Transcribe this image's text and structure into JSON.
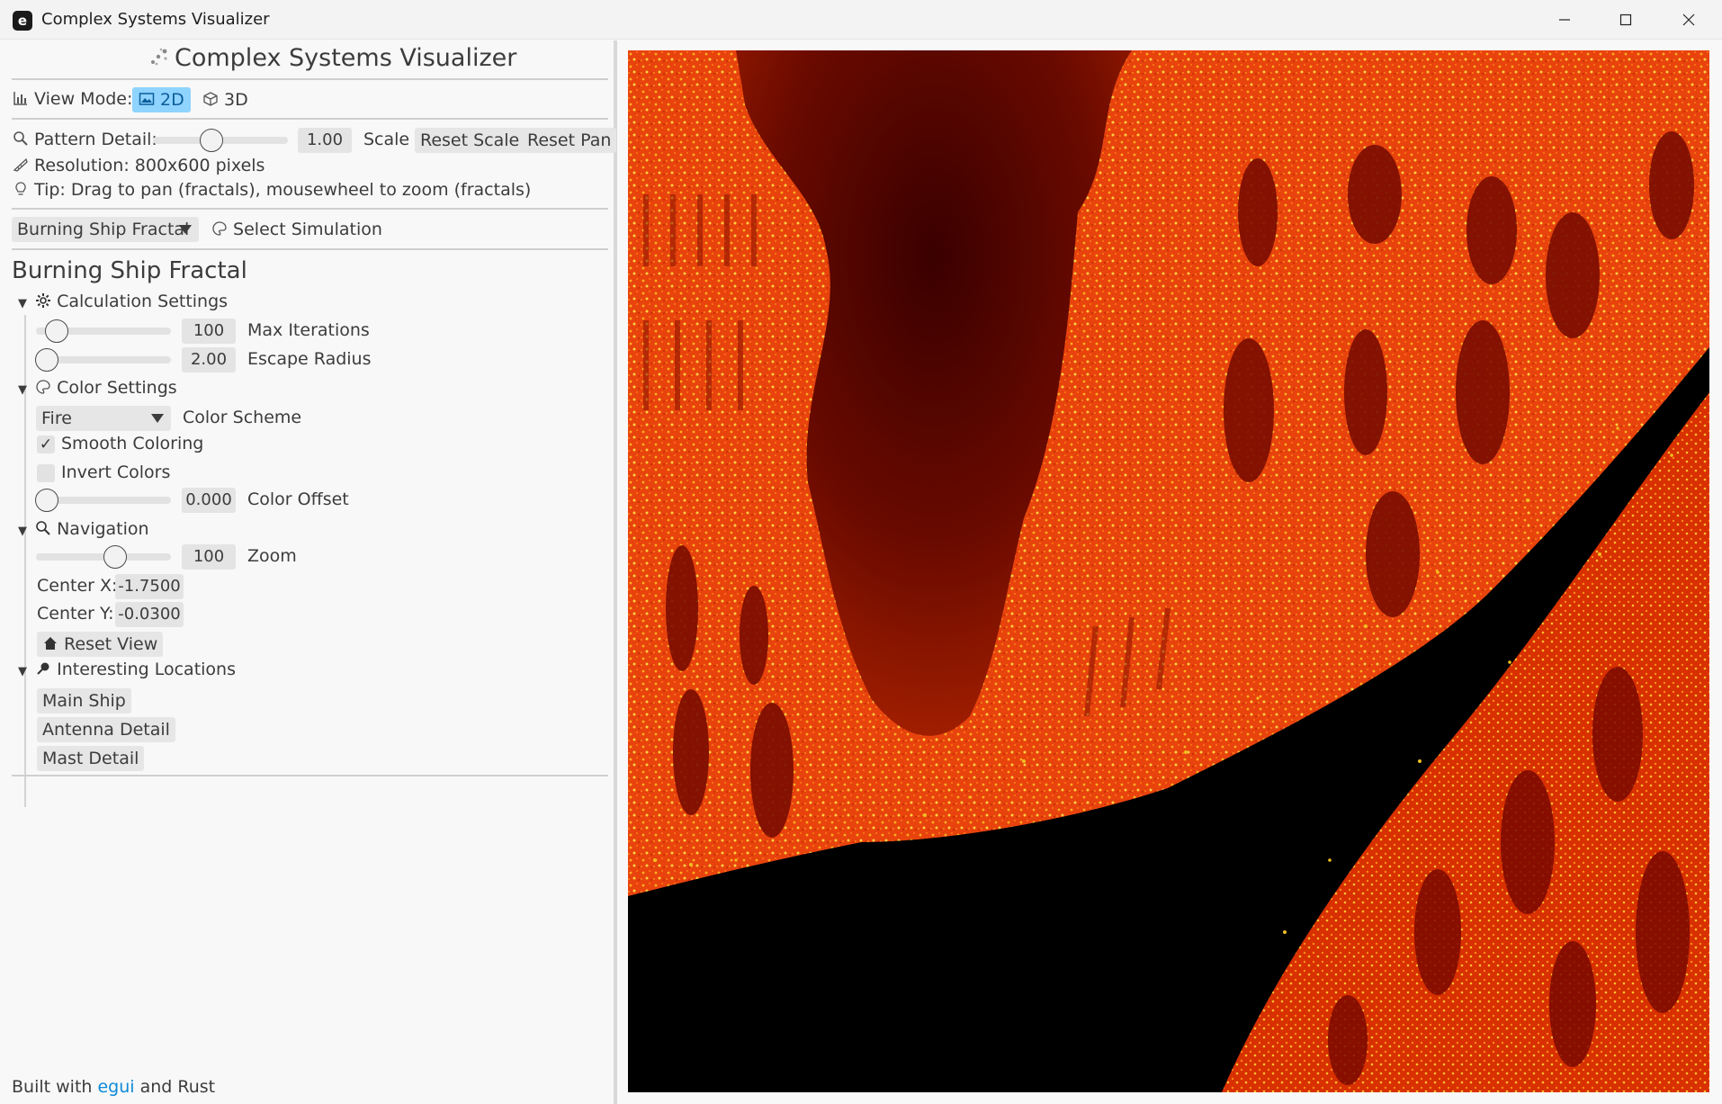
{
  "window": {
    "title": "Complex Systems Visualizer",
    "app_icon_letter": "e"
  },
  "header": {
    "title": "Complex Systems Visualizer"
  },
  "view_mode": {
    "label": "View Mode:",
    "option_2d": "2D",
    "option_3d": "3D",
    "selected": "2D"
  },
  "pattern": {
    "label": "Pattern Detail:",
    "scale_value": "1.00",
    "scale_label": "Scale",
    "reset_scale": "Reset Scale",
    "reset_pan": "Reset Pan"
  },
  "info": {
    "resolution": "Resolution: 800x600 pixels",
    "tip": "Tip: Drag to pan (fractals), mousewheel to zoom (fractals)"
  },
  "simulation": {
    "selected": "Burning Ship Fractal",
    "label": "Select Simulation"
  },
  "fractal": {
    "heading": "Burning Ship Fractal",
    "calc": {
      "title": "Calculation Settings",
      "max_iter_value": "100",
      "max_iter_label": "Max Iterations",
      "escape_value": "2.00",
      "escape_label": "Escape Radius"
    },
    "color": {
      "title": "Color Settings",
      "scheme_value": "Fire",
      "scheme_label": "Color Scheme",
      "smooth_label": "Smooth Coloring",
      "smooth_checked": true,
      "invert_label": "Invert Colors",
      "invert_checked": false,
      "offset_value": "0.000",
      "offset_label": "Color Offset"
    },
    "nav": {
      "title": "Navigation",
      "zoom_value": "100",
      "zoom_label": "Zoom",
      "center_x_label": "Center X:",
      "center_x_value": "-1.7500",
      "center_y_label": "Center Y:",
      "center_y_value": "-0.0300",
      "reset_view": "Reset View"
    },
    "locations": {
      "title": "Interesting Locations",
      "items": [
        "Main Ship",
        "Antenna Detail",
        "Mast Detail"
      ]
    }
  },
  "footer": {
    "prefix": "Built with",
    "link": "egui",
    "suffix": "and Rust"
  },
  "colors": {
    "accent": "#0f8ad8",
    "selected_bg": "#8fd3ff",
    "fire_dark": "#5a0000",
    "fire_mid": "#e63c0a",
    "fire_bright": "#ffa020"
  }
}
